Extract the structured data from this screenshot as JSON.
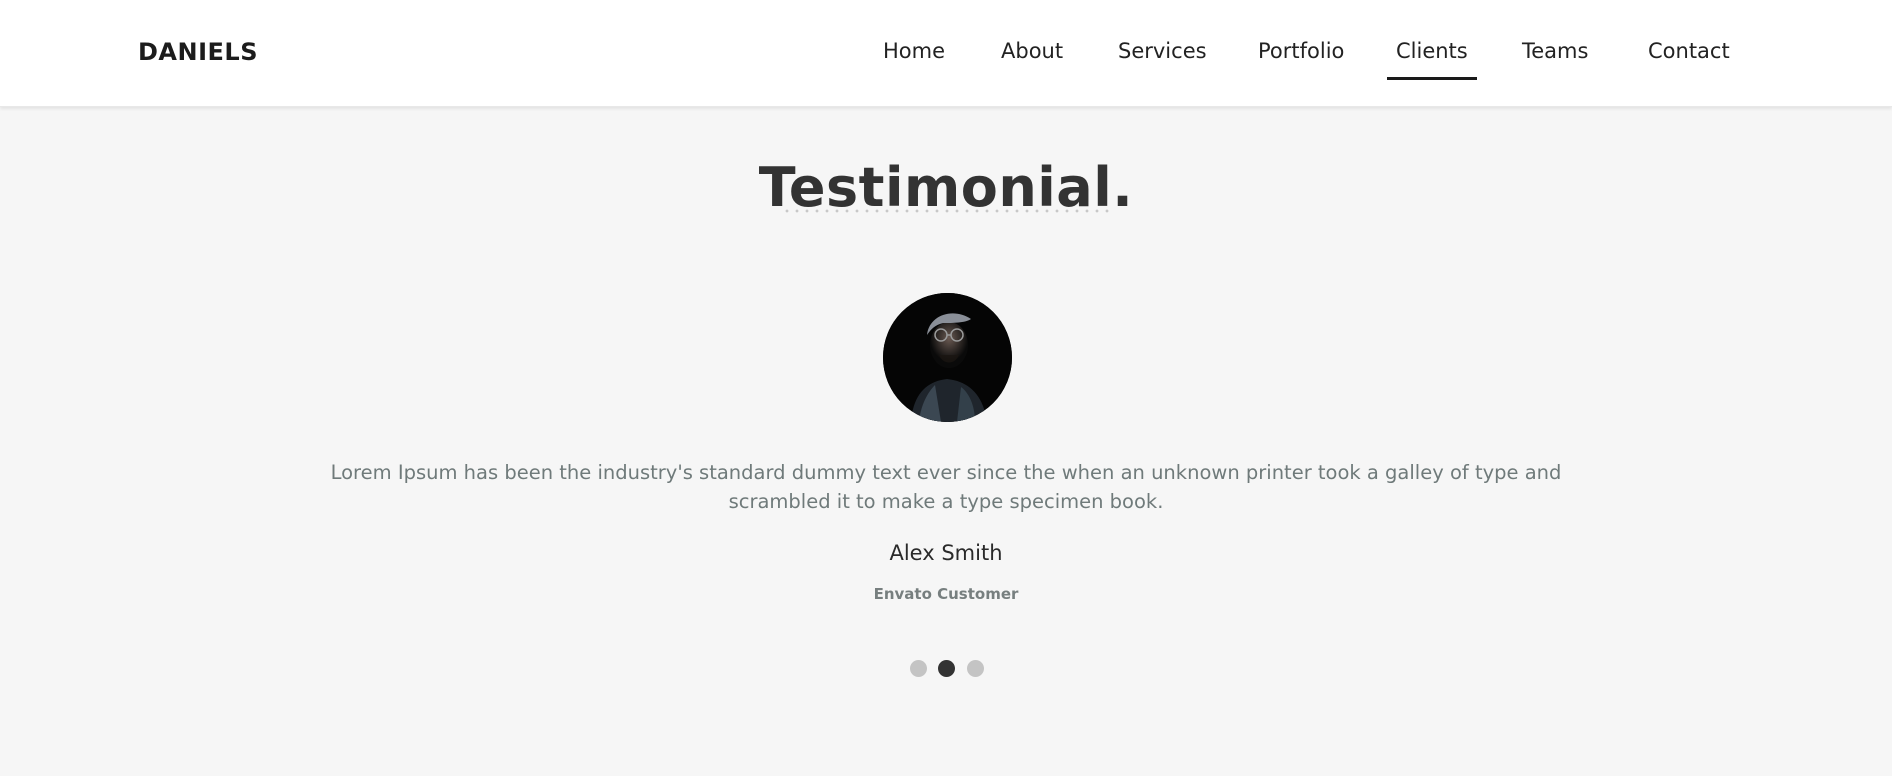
{
  "header": {
    "brand": "DANIELS",
    "nav": [
      {
        "label": "Home"
      },
      {
        "label": "About"
      },
      {
        "label": "Services"
      },
      {
        "label": "Portfolio"
      },
      {
        "label": "Clients"
      },
      {
        "label": "Teams"
      },
      {
        "label": "Contact"
      }
    ],
    "active_nav": "Clients"
  },
  "testimonial": {
    "title": "Testimonial.",
    "avatar_icon": "person-photo",
    "quote": "Lorem Ipsum has been the industry's standard dummy text ever since the when an unknown printer took a galley of type and scrambled it to make a type specimen book.",
    "name": "Alex Smith",
    "role": "Envato Customer",
    "slides": 3,
    "active_slide": 2
  },
  "colors": {
    "background": "#f6f6f6",
    "header_bg": "#ffffff",
    "title": "#333333",
    "text_muted": "#6f7a7a",
    "dot_inactive": "#c4c4c4",
    "dot_active": "#333333"
  }
}
